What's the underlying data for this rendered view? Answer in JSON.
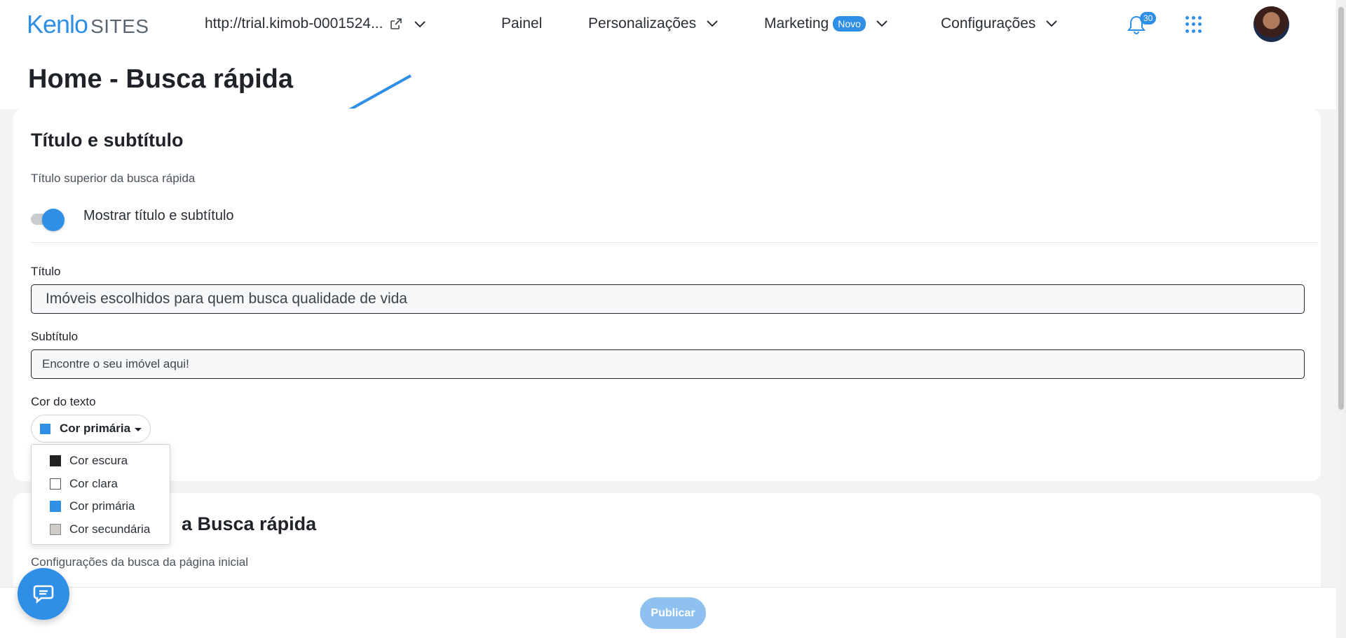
{
  "topbar": {
    "logo_main": "Kenlo",
    "logo_sub": "SITES",
    "site_url": "http://trial.kimob-0001524...",
    "nav": {
      "painel": "Painel",
      "personalizacoes": "Personalizações",
      "marketing": "Marketing",
      "marketing_badge": "Novo",
      "configuracoes": "Configurações"
    },
    "notifications_count": "30"
  },
  "page": {
    "title": "Home - Busca rápida"
  },
  "card1": {
    "title": "Título e subtítulo",
    "description": "Título superior da busca rápida",
    "toggle_label": "Mostrar título e subtítulo",
    "toggle_on": true,
    "title_label": "Título",
    "title_value": "Imóveis escolhidos para quem busca qualidade de vida",
    "subtitle_label": "Subtítulo",
    "subtitle_value": "Encontre o seu imóvel aqui!",
    "color_label": "Cor do texto",
    "color_selected": "Cor primária"
  },
  "color_options": [
    {
      "label": "Cor escura",
      "color": "#222222"
    },
    {
      "label": "Cor clara",
      "color": "#ffffff"
    },
    {
      "label": "Cor primária",
      "color": "#2f8fe6"
    },
    {
      "label": "Cor secundária",
      "color": "#cfcbc6"
    }
  ],
  "card2": {
    "title_partial": "a Busca rápida",
    "description": "Configurações da busca da página inicial"
  },
  "bottom": {
    "publish_label": "Publicar"
  },
  "colors": {
    "accent": "#2f8fe6",
    "publish_disabled": "#8ec1f0"
  }
}
